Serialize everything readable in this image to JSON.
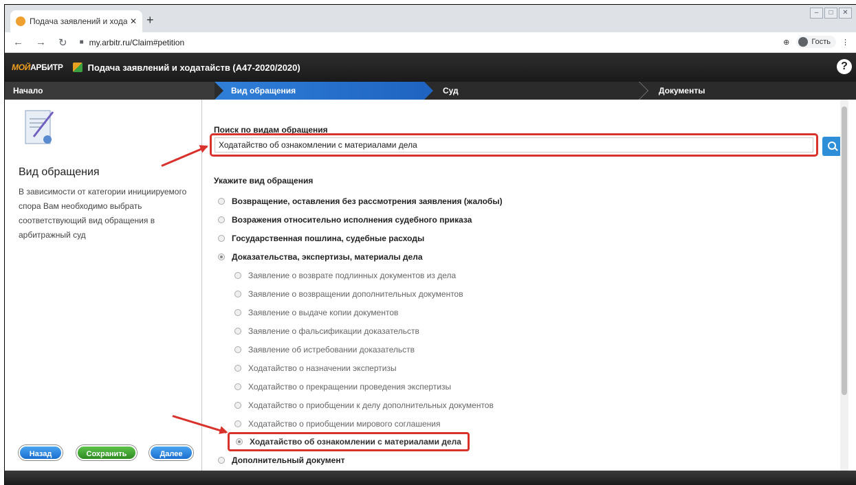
{
  "browser": {
    "tab_title": "Подача заявлений и ходатайст",
    "tab_close": "✕",
    "new_tab": "+",
    "url": "my.arbitr.ru/Claim#petition",
    "guest_label": "Гость",
    "menu": "⋮",
    "zoom": "⊕"
  },
  "app": {
    "logo_prefix": "МОЙ",
    "logo_main": "АРБИТР",
    "title": "Подача заявлений и ходатайств (А47-2020/2020)",
    "help": "?"
  },
  "steps": [
    {
      "label": "Начало"
    },
    {
      "label": "Вид обращения",
      "active": true
    },
    {
      "label": "Суд"
    },
    {
      "label": "Документы"
    }
  ],
  "left": {
    "heading": "Вид обращения",
    "description": "В зависимости от категории инициируемого спора Вам необходимо выбрать соответствующий вид обращения в арбитражный суд",
    "buttons": {
      "back": "Назад",
      "save": "Сохранить",
      "next": "Далее"
    }
  },
  "search": {
    "label": "Поиск по видам обращения",
    "value": "Ходатайство об ознакомлении с материалами дела"
  },
  "options": {
    "label": "Укажите вид обращения",
    "top": [
      "Возвращение, оставления без рассмотрения заявления (жалобы)",
      "Возражения относительно исполнения судебного приказа",
      "Государственная пошлина, судебные расходы",
      "Доказательства, экспертизы, материалы дела"
    ],
    "sub": [
      "Заявление о возврате подлинных документов из дела",
      "Заявление о возвращении дополнительных документов",
      "Заявление о выдаче копии документов",
      "Заявление о фальсификации доказательств",
      "Заявление об истребовании доказательств",
      "Ходатайство о назначении экспертизы",
      "Ходатайство о прекращении проведения экспертизы",
      "Ходатайство о приобщении к делу дополнительных документов",
      "Ходатайство о приобщении мирового соглашения"
    ],
    "selected": "Ходатайство об ознакомлении с материалами дела",
    "last": "Дополнительный документ"
  },
  "colors": {
    "accent_blue": "#2e8fd8",
    "highlight_red": "#d9312b",
    "save_green": "#3aa030"
  }
}
